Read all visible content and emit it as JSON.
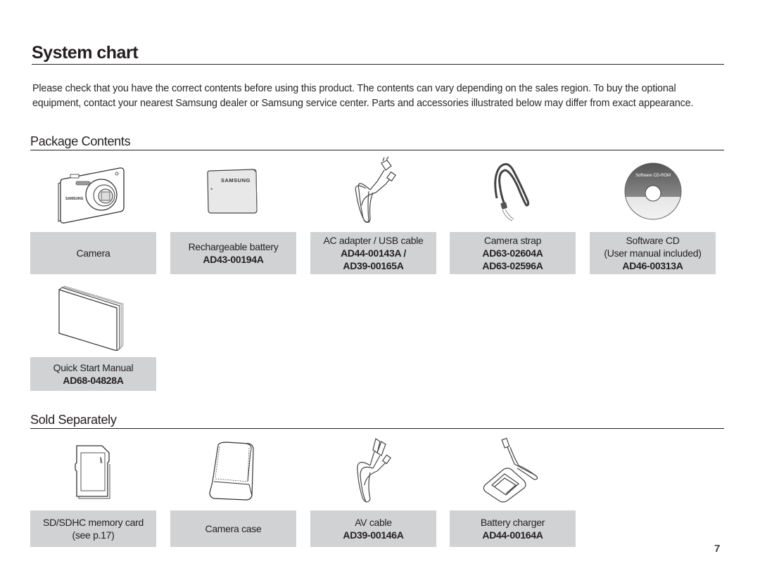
{
  "page": {
    "title": "System chart",
    "intro": "Please check that you have the correct contents before using this product. The contents can vary depending on the sales region. To buy the optional equipment, contact your nearest Samsung dealer or Samsung service center. Parts and accessories illustrated below may differ from exact appearance.",
    "page_number": "7"
  },
  "package_contents": {
    "heading": "Package Contents",
    "items": [
      {
        "name": "Camera",
        "lines": [
          "Camera"
        ],
        "part_numbers": [],
        "icon": "camera-icon"
      },
      {
        "name": "Rechargeable battery",
        "lines": [
          "Rechargeable battery"
        ],
        "part_numbers": [
          "AD43-00194A"
        ],
        "icon": "battery-icon"
      },
      {
        "name": "AC adapter / USB cable",
        "lines": [
          "AC adapter / USB cable"
        ],
        "part_numbers": [
          "AD44-00143A /",
          "AD39-00165A"
        ],
        "icon": "ac-adapter-usb-cable-icon"
      },
      {
        "name": "Camera strap",
        "lines": [
          "Camera strap"
        ],
        "part_numbers": [
          "AD63-02604A",
          "AD63-02596A"
        ],
        "icon": "camera-strap-icon"
      },
      {
        "name": "Software CD",
        "lines": [
          "Software CD",
          "(User manual included)"
        ],
        "part_numbers": [
          "AD46-00313A"
        ],
        "icon": "software-cd-icon",
        "disc_text": "Software CD-ROM"
      },
      {
        "name": "Quick Start Manual",
        "lines": [
          "Quick Start Manual"
        ],
        "part_numbers": [
          "AD68-04828A"
        ],
        "icon": "manual-icon"
      }
    ]
  },
  "sold_separately": {
    "heading": "Sold Separately",
    "items": [
      {
        "name": "SD/SDHC memory card",
        "lines": [
          "SD/SDHC memory card",
          "(see p.17)"
        ],
        "part_numbers": [],
        "icon": "memory-card-icon"
      },
      {
        "name": "Camera case",
        "lines": [
          "Camera case"
        ],
        "part_numbers": [],
        "icon": "camera-case-icon"
      },
      {
        "name": "AV cable",
        "lines": [
          "AV cable"
        ],
        "part_numbers": [
          "AD39-00146A"
        ],
        "icon": "av-cable-icon"
      },
      {
        "name": "Battery charger",
        "lines": [
          "Battery charger"
        ],
        "part_numbers": [
          "AD44-00164A"
        ],
        "icon": "battery-charger-icon"
      }
    ]
  },
  "brand_text": "SAMSUNG"
}
